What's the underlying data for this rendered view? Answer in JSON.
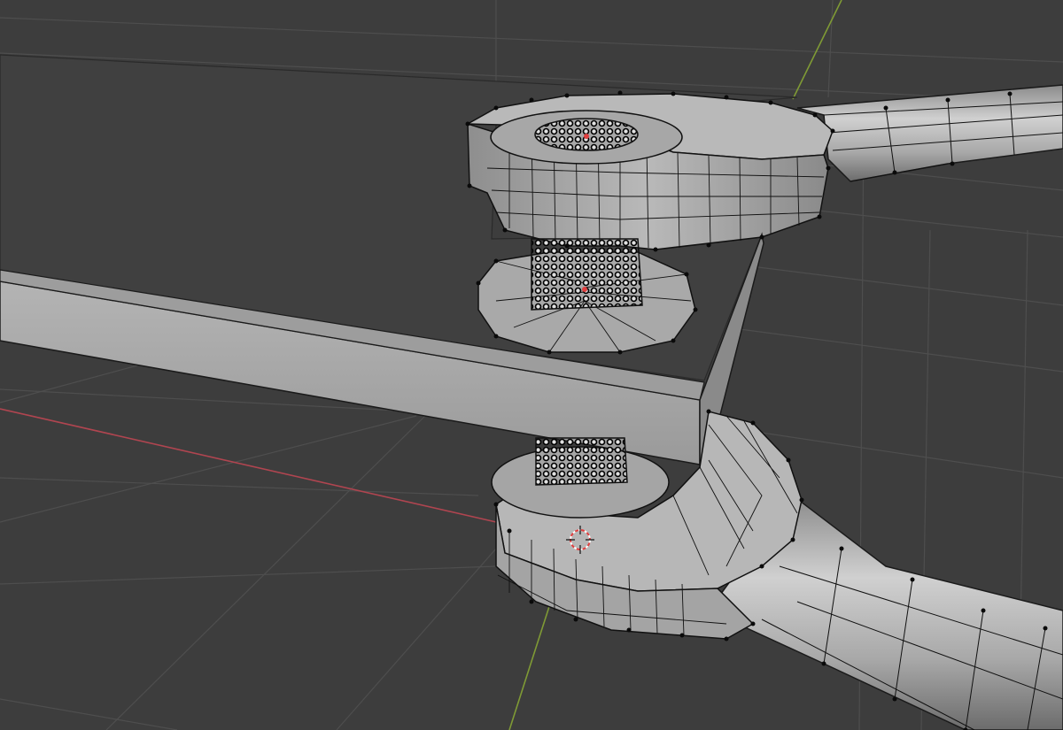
{
  "viewport": {
    "mode": "edit-mode",
    "shading": "solid",
    "colors": {
      "background": "#3d3d3d",
      "grid_line": "#4d4d4d",
      "grid_line_bright": "#555555",
      "x_axis": "#b04550",
      "y_axis": "#7f9a35",
      "mesh_light": "#b5b5b5",
      "mesh_mid": "#9a9a9a",
      "mesh_dark": "#6e6e6e",
      "wire": "#111111",
      "vertex": "#0a0a0a",
      "cursor_red": "#e04040"
    }
  },
  "scene_objects": [
    {
      "name": "board-plate",
      "icon": "mesh-object-icon"
    },
    {
      "name": "upper-wrench",
      "icon": "mesh-object-icon"
    },
    {
      "name": "upper-bolt-head",
      "icon": "mesh-object-icon"
    },
    {
      "name": "upper-washer",
      "icon": "mesh-object-icon"
    },
    {
      "name": "lower-wrench",
      "icon": "mesh-object-icon"
    },
    {
      "name": "lower-bolt",
      "icon": "mesh-object-icon"
    },
    {
      "name": "3d-cursor",
      "icon": "crosshair-icon"
    }
  ]
}
